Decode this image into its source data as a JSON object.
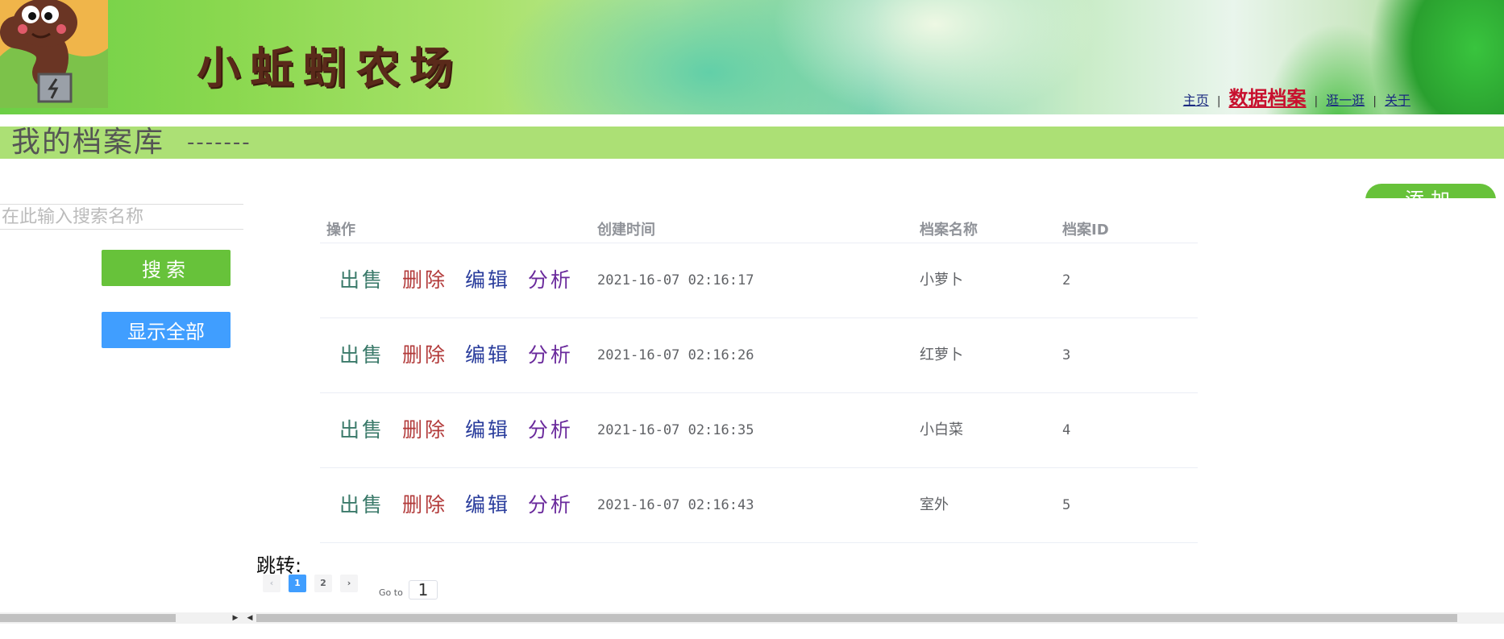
{
  "header": {
    "brand_title": "小蚯蚓农场",
    "nav": [
      {
        "label": "主页",
        "active": false
      },
      {
        "label": "数据档案",
        "active": true
      },
      {
        "label": "逛一逛",
        "active": false
      },
      {
        "label": "关于",
        "active": false
      }
    ],
    "nav_separator": "|"
  },
  "section": {
    "title": "我的档案库",
    "dashes": "-------"
  },
  "sidebar": {
    "search_placeholder": "在此输入搜索名称",
    "search_value": "",
    "search_button": "搜索",
    "show_all_button": "显示全部"
  },
  "add_button": "添加",
  "table": {
    "columns": [
      "操作",
      "创建时间",
      "档案名称",
      "档案ID"
    ],
    "actions": {
      "sell": "出售",
      "delete": "删除",
      "edit": "编辑",
      "analyze": "分析"
    },
    "rows": [
      {
        "created": "2021-16-07 02:16:17",
        "name": "小萝卜",
        "id": "2"
      },
      {
        "created": "2021-16-07 02:16:26",
        "name": "红萝卜",
        "id": "3"
      },
      {
        "created": "2021-16-07 02:16:35",
        "name": "小白菜",
        "id": "4"
      },
      {
        "created": "2021-16-07 02:16:43",
        "name": "室外",
        "id": "5"
      }
    ]
  },
  "pager": {
    "jump_label": "跳转:",
    "prev": "‹",
    "next": "›",
    "pages": [
      "1",
      "2"
    ],
    "current_page": "1",
    "goto_label": "Go to",
    "goto_value": "1"
  },
  "colors": {
    "section_bar": "#ace075",
    "search_button": "#67c23a",
    "show_all_button": "#409eff",
    "active_nav": "#c8102e"
  },
  "icons": {
    "logo": "earthworm-mascot-icon",
    "scroll_right": "triangle-right-icon",
    "scroll_left": "triangle-left-icon"
  }
}
